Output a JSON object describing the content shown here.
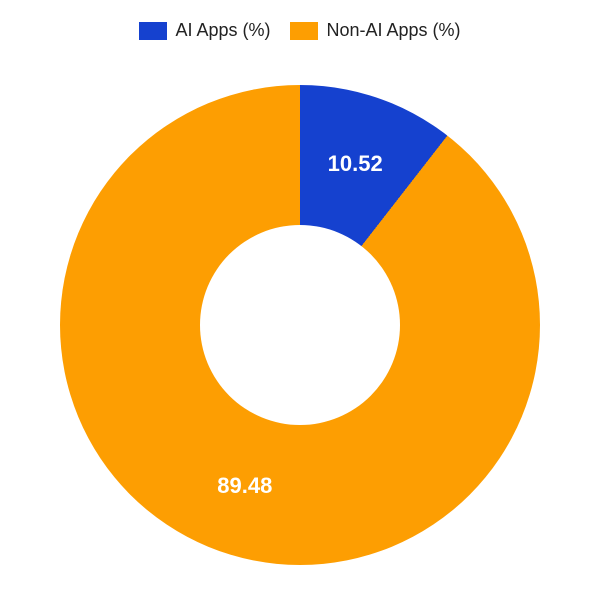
{
  "chart_data": {
    "type": "pie",
    "series": [
      {
        "name": "AI Apps (%)",
        "value": 10.52,
        "color": "#1541cf"
      },
      {
        "name": "Non-AI Apps (%)",
        "value": 89.48,
        "color": "#fd9e02"
      }
    ],
    "donut_hole_ratio": 0.42,
    "start_angle_deg": 0,
    "data_labels": true
  },
  "legend": {
    "items": [
      {
        "label": "AI Apps (%)",
        "color": "#1541cf"
      },
      {
        "label": "Non-AI Apps (%)",
        "color": "#fd9e02"
      }
    ]
  }
}
